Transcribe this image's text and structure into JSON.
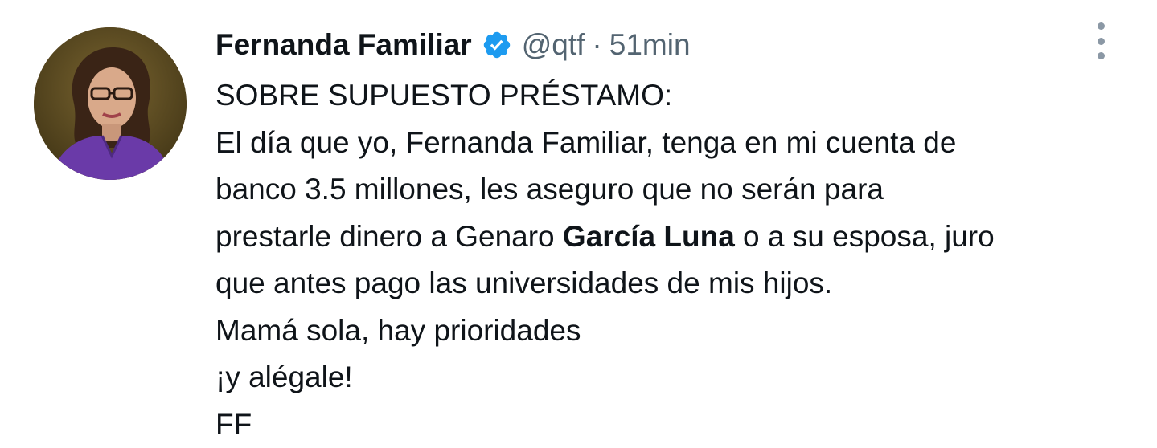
{
  "user": {
    "display_name": "Fernanda Familiar",
    "handle": "@qtf",
    "separator": "·",
    "time": "51min",
    "verified_icon": "verified-badge-icon",
    "verified_color": "#1d9bf0"
  },
  "tweet": {
    "line1": "SOBRE SUPUESTO PRÉSTAMO:",
    "line2": "El día que yo, Fernanda Familiar, tenga en mi cuenta de",
    "line3": "banco 3.5 millones, les aseguro que no serán para",
    "line4_pre": "prestarle dinero a Genaro ",
    "line4_bold": "García Luna",
    "line4_post": " o a su esposa, juro",
    "line5": "que antes pago las universidades de mis hijos.",
    "line6": "Mamá sola, hay prioridades",
    "line7": "¡y alégale!",
    "line8": "FF"
  },
  "icons": {
    "more": "more-vertical-icon",
    "avatar": "avatar"
  },
  "colors": {
    "text_primary": "#0f1419",
    "text_secondary": "#536471",
    "accent": "#1d9bf0"
  }
}
